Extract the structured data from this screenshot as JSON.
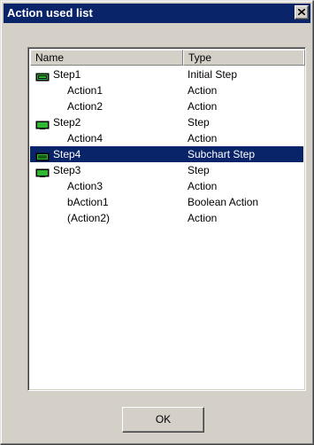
{
  "window": {
    "title": "Action used list"
  },
  "list": {
    "columns": [
      {
        "label": "Name"
      },
      {
        "label": "Type"
      }
    ],
    "rows": [
      {
        "name": "Step1",
        "type": "Initial Step",
        "icon": "initial-step-icon",
        "level": 0
      },
      {
        "name": "Action1",
        "type": "Action",
        "icon": "",
        "level": 1
      },
      {
        "name": "Action2",
        "type": "Action",
        "icon": "",
        "level": 1
      },
      {
        "name": "Step2",
        "type": "Step",
        "icon": "step-icon",
        "level": 0
      },
      {
        "name": "Action4",
        "type": "Action",
        "icon": "",
        "level": 1
      },
      {
        "name": "Step4",
        "type": "Subchart Step",
        "icon": "subchart-step-icon",
        "level": 0,
        "selected": true
      },
      {
        "name": "Step3",
        "type": "Step",
        "icon": "step-icon",
        "level": 0
      },
      {
        "name": "Action3",
        "type": "Action",
        "icon": "",
        "level": 1
      },
      {
        "name": "bAction1",
        "type": "Boolean Action",
        "icon": "",
        "level": 1
      },
      {
        "name": "(Action2)",
        "type": "Action",
        "icon": "",
        "level": 1
      }
    ]
  },
  "buttons": {
    "ok_label": "OK"
  },
  "colors": {
    "titlebar": "#0a246a",
    "selection": "#0a246a",
    "face": "#d4d0c8",
    "step_icon": "#2fb52f"
  }
}
